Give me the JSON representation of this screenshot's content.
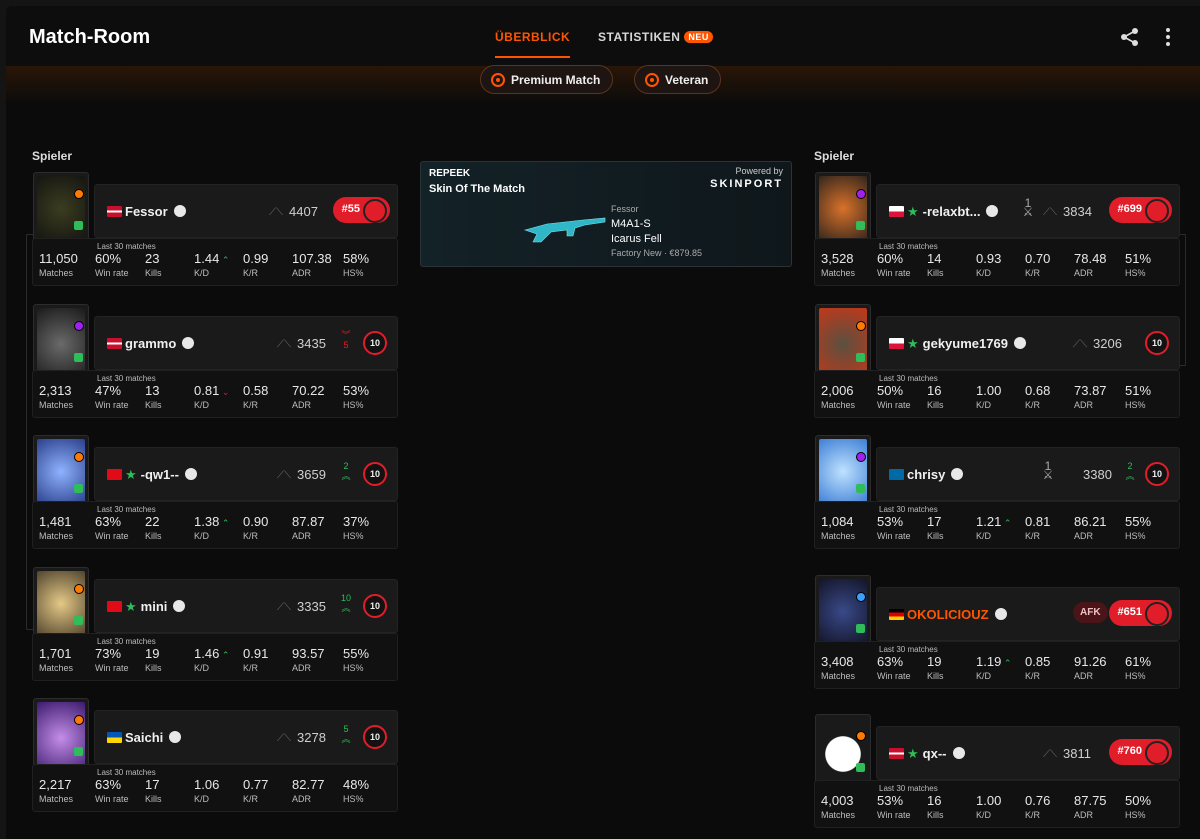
{
  "header": {
    "title": "Match-Room",
    "tab_overview": "ÜBERBLICK",
    "tab_stats": "STATISTIKEN",
    "neu_badge": "NEU"
  },
  "badges": {
    "premium": "Premium Match",
    "veteran": "Veteran"
  },
  "labels": {
    "players_left": "Spieler",
    "players_right": "Spieler",
    "last30": "Last 30 matches",
    "matches": "Matches",
    "winrate": "Win rate",
    "kills": "Kills",
    "kd": "K/D",
    "kr": "K/R",
    "adr": "ADR",
    "hs": "HS%"
  },
  "skin": {
    "brand": "REPEEK",
    "title": "Skin Of The Match",
    "powered": "Powered by",
    "provider": "SKINPORT",
    "owner": "Fessor",
    "weapon": "M4A1-S",
    "skin_name": "Icarus Fell",
    "condition": "Factory New · €879.85"
  },
  "left": [
    {
      "name": "Fessor",
      "flag": "DK",
      "elo": "4407",
      "rank": "#55",
      "matches": "11,050",
      "winrate": "60%",
      "kills": "23",
      "kd": "1.44",
      "kr": "0.99",
      "adr": "107.38",
      "hs": "58%"
    },
    {
      "name": "grammo",
      "flag": "DK",
      "elo": "3435",
      "delta": "5",
      "delta_dir": "down",
      "level": "10",
      "matches": "2,313",
      "winrate": "47%",
      "kills": "13",
      "kd": "0.81",
      "kr": "0.58",
      "adr": "70.22",
      "hs": "53%"
    },
    {
      "name": "-qw1--",
      "flag": "TR",
      "elo": "3659",
      "delta": "2",
      "delta_dir": "up",
      "level": "10",
      "matches": "1,481",
      "winrate": "63%",
      "kills": "22",
      "kd": "1.38",
      "kr": "0.90",
      "adr": "87.87",
      "hs": "37%"
    },
    {
      "name": "mini",
      "flag": "TR",
      "elo": "3335",
      "delta": "10",
      "delta_dir": "up",
      "level": "10",
      "matches": "1,701",
      "winrate": "73%",
      "kills": "19",
      "kd": "1.46",
      "kr": "0.91",
      "adr": "93.57",
      "hs": "55%"
    },
    {
      "name": "Saichi",
      "flag": "UA",
      "elo": "3278",
      "delta": "5",
      "delta_dir": "up",
      "level": "10",
      "matches": "2,217",
      "winrate": "63%",
      "kills": "17",
      "kd": "1.06",
      "kr": "0.77",
      "adr": "82.77",
      "hs": "48%"
    }
  ],
  "right": [
    {
      "name": "-relaxbt...",
      "flag": "PL",
      "elo": "3834",
      "rank": "#699",
      "swords": "1",
      "matches": "3,528",
      "winrate": "60%",
      "kills": "14",
      "kd": "0.93",
      "kr": "0.70",
      "adr": "78.48",
      "hs": "51%"
    },
    {
      "name": "gekyume1769",
      "flag": "PL",
      "elo": "3206",
      "level": "10",
      "matches": "2,006",
      "winrate": "50%",
      "kills": "16",
      "kd": "1.00",
      "kr": "0.68",
      "adr": "73.87",
      "hs": "51%"
    },
    {
      "name": "chrisy",
      "flag": "SE",
      "elo": "3380",
      "swords": "1",
      "delta": "2",
      "delta_dir": "up",
      "level": "10",
      "matches": "1,084",
      "winrate": "53%",
      "kills": "17",
      "kd": "1.21",
      "kr": "0.81",
      "adr": "86.21",
      "hs": "55%"
    },
    {
      "name": "OKOLICIOUZ",
      "flag": "DE",
      "afk": "AFK",
      "rank": "#651",
      "matches": "3,408",
      "winrate": "63%",
      "kills": "19",
      "kd": "1.19",
      "kr": "0.85",
      "adr": "91.26",
      "hs": "61%"
    },
    {
      "name": "qx--",
      "flag": "DK",
      "elo": "3811",
      "rank": "#760",
      "matches": "4,003",
      "winrate": "53%",
      "kills": "16",
      "kd": "1.00",
      "kr": "0.76",
      "adr": "87.75",
      "hs": "50%"
    }
  ]
}
